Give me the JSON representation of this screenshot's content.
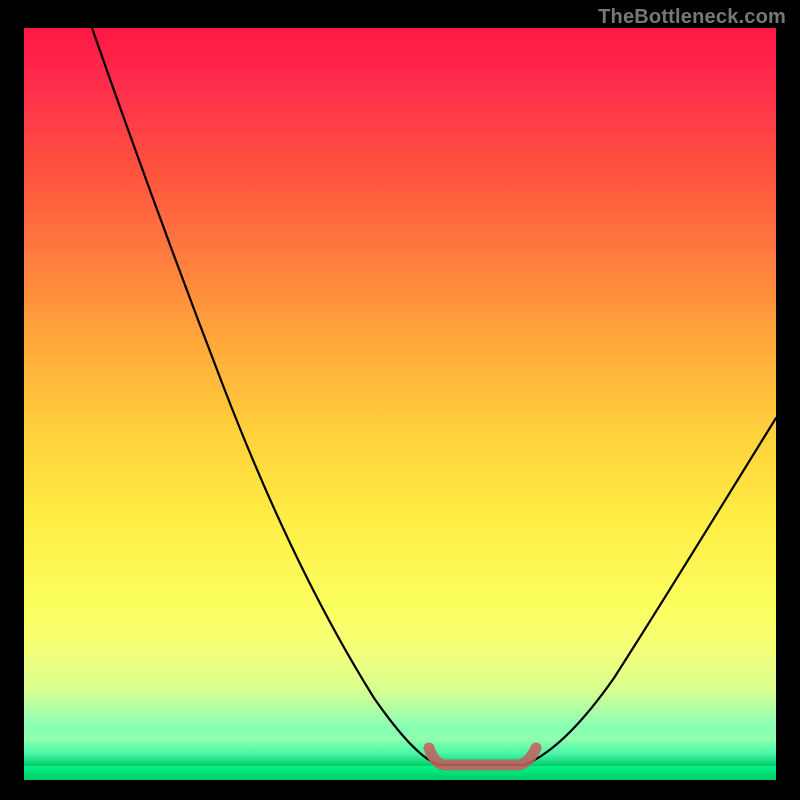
{
  "watermark": "TheBottleneck.com",
  "chart_data": {
    "type": "line",
    "title": "",
    "xlabel": "",
    "ylabel": "",
    "xlim": [
      0,
      100
    ],
    "ylim": [
      0,
      100
    ],
    "grid": false,
    "legend": false,
    "series": [
      {
        "name": "bottleneck-curve",
        "x": [
          10,
          15,
          20,
          25,
          30,
          35,
          40,
          45,
          50,
          53,
          55,
          58,
          60,
          63,
          65,
          70,
          75,
          80,
          85,
          90,
          95,
          100
        ],
        "values": [
          100,
          88,
          76,
          65,
          54,
          44,
          34,
          25,
          16,
          10,
          6,
          2,
          0,
          0,
          0,
          5,
          12,
          20,
          28,
          36,
          44,
          52
        ]
      }
    ],
    "annotations": [
      {
        "name": "optimal-valley",
        "x_start": 55,
        "x_end": 67,
        "y": 2
      }
    ],
    "background": "rainbow-gradient-red-to-green"
  }
}
